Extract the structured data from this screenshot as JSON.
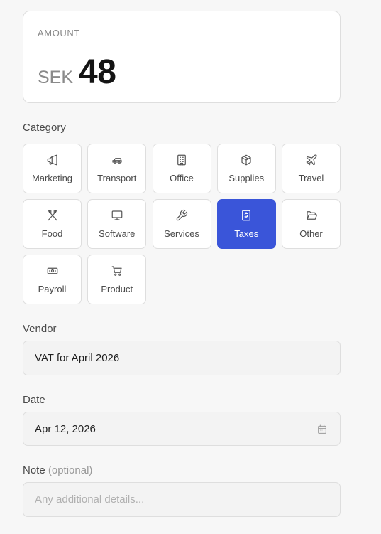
{
  "amount": {
    "label": "AMOUNT",
    "currency": "SEK",
    "value": "48"
  },
  "category": {
    "label": "Category",
    "selected": "Taxes",
    "accent_color": "#3a55d9",
    "items": [
      {
        "label": "Marketing",
        "icon": "megaphone-icon"
      },
      {
        "label": "Transport",
        "icon": "car-icon"
      },
      {
        "label": "Office",
        "icon": "building-icon"
      },
      {
        "label": "Supplies",
        "icon": "package-icon"
      },
      {
        "label": "Travel",
        "icon": "plane-icon"
      },
      {
        "label": "Food",
        "icon": "utensils-icon"
      },
      {
        "label": "Software",
        "icon": "monitor-icon"
      },
      {
        "label": "Services",
        "icon": "wrench-icon"
      },
      {
        "label": "Taxes",
        "icon": "receipt-dollar-icon"
      },
      {
        "label": "Other",
        "icon": "folder-open-icon"
      },
      {
        "label": "Payroll",
        "icon": "banknote-icon"
      },
      {
        "label": "Product",
        "icon": "shopping-cart-icon"
      }
    ]
  },
  "vendor": {
    "label": "Vendor",
    "value": "VAT for April 2026"
  },
  "date": {
    "label": "Date",
    "value": "Apr 12, 2026",
    "icon": "calendar-icon"
  },
  "note": {
    "label": "Note",
    "optional_label": "(optional)",
    "placeholder": "Any additional details..."
  }
}
